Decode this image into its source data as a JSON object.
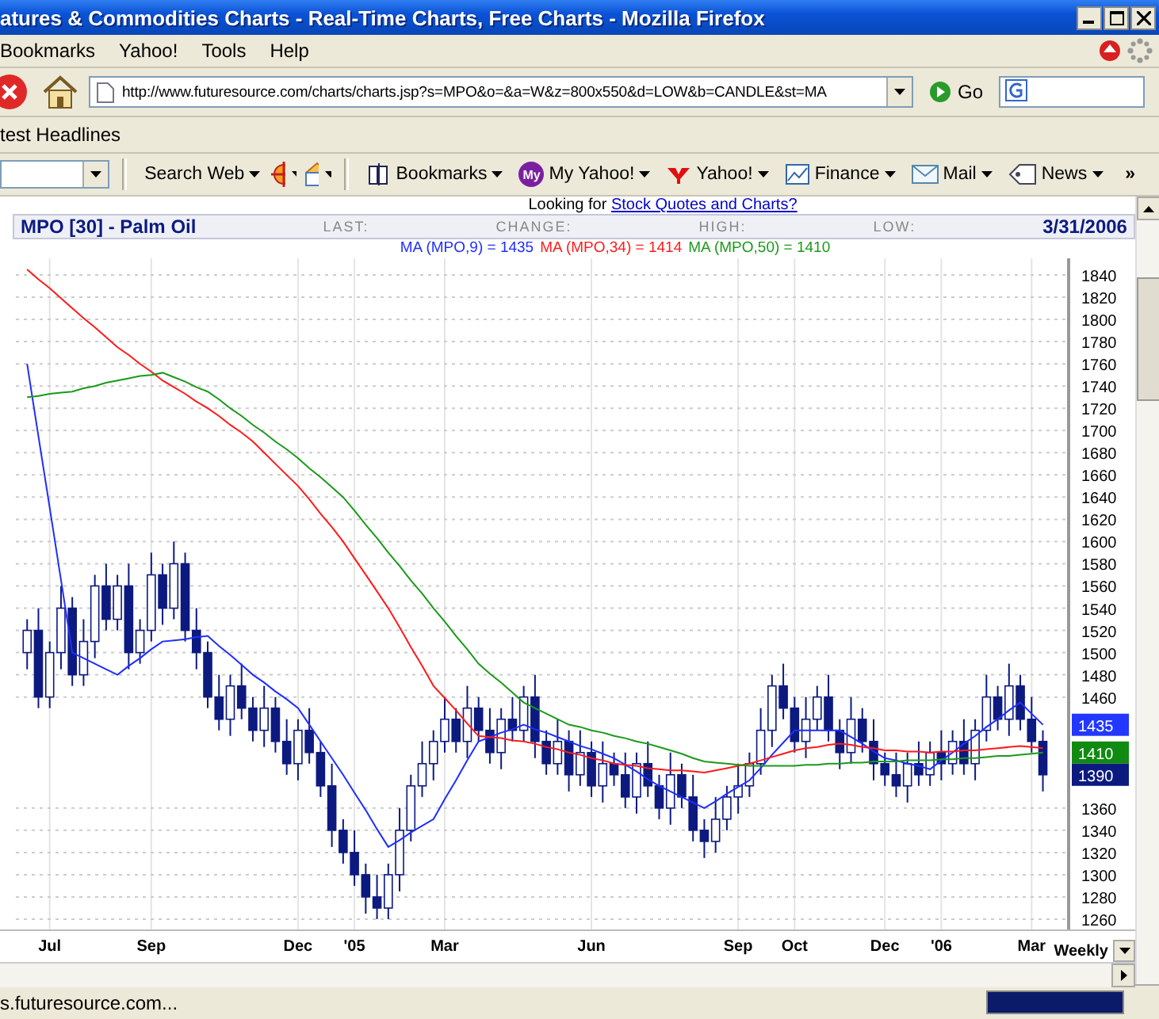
{
  "window": {
    "title": "atures & Commodities Charts - Real-Time Charts, Free Charts - Mozilla Firefox"
  },
  "menu": [
    "Bookmarks",
    "Yahoo!",
    "Tools",
    "Help"
  ],
  "navigation": {
    "url": "http://www.futuresource.com/charts/charts.jsp?s=MPO&o=&a=W&z=800x550&d=LOW&b=CANDLE&st=MA",
    "go": "Go"
  },
  "bookmarks_bar": {
    "items": [
      "test Headlines"
    ]
  },
  "yahoo_toolbar": {
    "search_button": "Search Web",
    "items": [
      {
        "kind": "bookmarks",
        "label": "Bookmarks"
      },
      {
        "kind": "myyahoo",
        "label": "My Yahoo!",
        "icon_text": "My"
      },
      {
        "kind": "yahoo",
        "label": "Yahoo!"
      },
      {
        "kind": "finance",
        "label": "Finance"
      },
      {
        "kind": "mail",
        "label": "Mail"
      },
      {
        "kind": "news",
        "label": "News"
      }
    ],
    "overflow": "»"
  },
  "page": {
    "promo": {
      "text": "Looking for",
      "link": "Stock Quotes and Charts?"
    },
    "chart": {
      "title": "MPO [30] - Palm Oil",
      "fields": [
        "LAST:",
        "CHANGE:",
        "HIGH:",
        "LOW:"
      ],
      "date": "3/31/2006",
      "legend_values": [
        "= 1435",
        "= 1414",
        "= 1410"
      ],
      "price_tags": [
        {
          "text": "1435",
          "color": "#2238ff"
        },
        {
          "text": "1410",
          "color": "#108a10"
        },
        {
          "text": "1390",
          "color": "#0c1a80"
        }
      ],
      "period": "Weekly",
      "chart_data": {
        "type": "candlestick",
        "ylim": [
          1250,
          1855
        ],
        "grid": true,
        "categories": [
          null,
          null,
          "Jul",
          null,
          null,
          null,
          null,
          null,
          null,
          null,
          null,
          "Sep",
          null,
          null,
          null,
          null,
          null,
          null,
          null,
          null,
          null,
          null,
          null,
          null,
          "Dec",
          null,
          null,
          null,
          null,
          "'05",
          null,
          null,
          null,
          null,
          null,
          null,
          null,
          "Mar",
          null,
          null,
          null,
          null,
          null,
          null,
          null,
          null,
          null,
          null,
          null,
          null,
          "Jun",
          null,
          null,
          null,
          null,
          null,
          null,
          null,
          null,
          null,
          null,
          null,
          null,
          "Sep",
          null,
          null,
          null,
          null,
          "Oct",
          null,
          null,
          null,
          null,
          null,
          null,
          null,
          "Dec",
          null,
          null,
          null,
          null,
          "'06",
          null,
          null,
          null,
          null,
          null,
          null,
          null,
          "Mar",
          null
        ],
        "yticks": [
          1260,
          1280,
          1300,
          1320,
          1340,
          1360,
          1460,
          1480,
          1500,
          1520,
          1540,
          1560,
          1580,
          1600,
          1620,
          1640,
          1660,
          1680,
          1700,
          1720,
          1740,
          1760,
          1780,
          1800,
          1820,
          1840
        ],
        "ohlc": [
          [
            1500,
            1530,
            1485,
            1520
          ],
          [
            1520,
            1540,
            1450,
            1460
          ],
          [
            1460,
            1510,
            1450,
            1500
          ],
          [
            1500,
            1560,
            1485,
            1540
          ],
          [
            1540,
            1550,
            1470,
            1480
          ],
          [
            1480,
            1530,
            1470,
            1510
          ],
          [
            1510,
            1570,
            1495,
            1560
          ],
          [
            1560,
            1580,
            1520,
            1530
          ],
          [
            1530,
            1570,
            1520,
            1560
          ],
          [
            1560,
            1580,
            1485,
            1500
          ],
          [
            1500,
            1530,
            1490,
            1520
          ],
          [
            1520,
            1590,
            1510,
            1570
          ],
          [
            1570,
            1580,
            1525,
            1540
          ],
          [
            1540,
            1600,
            1530,
            1580
          ],
          [
            1580,
            1590,
            1510,
            1520
          ],
          [
            1520,
            1540,
            1485,
            1500
          ],
          [
            1500,
            1510,
            1450,
            1460
          ],
          [
            1460,
            1480,
            1430,
            1440
          ],
          [
            1440,
            1480,
            1425,
            1470
          ],
          [
            1470,
            1490,
            1440,
            1450
          ],
          [
            1450,
            1460,
            1420,
            1430
          ],
          [
            1430,
            1470,
            1415,
            1450
          ],
          [
            1450,
            1460,
            1410,
            1420
          ],
          [
            1420,
            1440,
            1390,
            1400
          ],
          [
            1400,
            1440,
            1385,
            1430
          ],
          [
            1430,
            1450,
            1400,
            1410
          ],
          [
            1410,
            1420,
            1370,
            1380
          ],
          [
            1380,
            1400,
            1325,
            1340
          ],
          [
            1340,
            1350,
            1310,
            1320
          ],
          [
            1320,
            1340,
            1290,
            1300
          ],
          [
            1300,
            1310,
            1265,
            1280
          ],
          [
            1280,
            1300,
            1260,
            1270
          ],
          [
            1270,
            1310,
            1260,
            1300
          ],
          [
            1300,
            1360,
            1285,
            1340
          ],
          [
            1340,
            1390,
            1330,
            1380
          ],
          [
            1380,
            1420,
            1370,
            1400
          ],
          [
            1400,
            1430,
            1385,
            1420
          ],
          [
            1420,
            1460,
            1410,
            1440
          ],
          [
            1440,
            1450,
            1410,
            1420
          ],
          [
            1420,
            1470,
            1405,
            1450
          ],
          [
            1450,
            1460,
            1420,
            1430
          ],
          [
            1430,
            1450,
            1400,
            1410
          ],
          [
            1410,
            1450,
            1395,
            1440
          ],
          [
            1440,
            1460,
            1420,
            1430
          ],
          [
            1430,
            1470,
            1420,
            1460
          ],
          [
            1460,
            1480,
            1405,
            1420
          ],
          [
            1420,
            1430,
            1390,
            1400
          ],
          [
            1400,
            1440,
            1390,
            1420
          ],
          [
            1420,
            1430,
            1375,
            1390
          ],
          [
            1390,
            1430,
            1380,
            1410
          ],
          [
            1410,
            1420,
            1370,
            1380
          ],
          [
            1380,
            1420,
            1365,
            1400
          ],
          [
            1400,
            1410,
            1380,
            1390
          ],
          [
            1390,
            1410,
            1360,
            1370
          ],
          [
            1370,
            1410,
            1355,
            1400
          ],
          [
            1400,
            1420,
            1370,
            1380
          ],
          [
            1380,
            1390,
            1350,
            1360
          ],
          [
            1360,
            1410,
            1345,
            1390
          ],
          [
            1390,
            1400,
            1360,
            1370
          ],
          [
            1370,
            1390,
            1330,
            1340
          ],
          [
            1340,
            1350,
            1315,
            1330
          ],
          [
            1330,
            1370,
            1320,
            1350
          ],
          [
            1350,
            1380,
            1340,
            1370
          ],
          [
            1370,
            1400,
            1355,
            1380
          ],
          [
            1380,
            1410,
            1370,
            1400
          ],
          [
            1400,
            1450,
            1390,
            1430
          ],
          [
            1430,
            1480,
            1415,
            1470
          ],
          [
            1470,
            1490,
            1440,
            1450
          ],
          [
            1450,
            1460,
            1410,
            1420
          ],
          [
            1420,
            1460,
            1405,
            1440
          ],
          [
            1440,
            1470,
            1430,
            1460
          ],
          [
            1460,
            1480,
            1420,
            1430
          ],
          [
            1430,
            1440,
            1395,
            1410
          ],
          [
            1410,
            1460,
            1400,
            1440
          ],
          [
            1440,
            1450,
            1410,
            1420
          ],
          [
            1420,
            1440,
            1385,
            1400
          ],
          [
            1400,
            1410,
            1380,
            1390
          ],
          [
            1390,
            1410,
            1370,
            1380
          ],
          [
            1380,
            1410,
            1365,
            1400
          ],
          [
            1400,
            1420,
            1380,
            1390
          ],
          [
            1390,
            1420,
            1380,
            1410
          ],
          [
            1410,
            1430,
            1385,
            1400
          ],
          [
            1400,
            1430,
            1390,
            1420
          ],
          [
            1420,
            1440,
            1390,
            1400
          ],
          [
            1400,
            1440,
            1385,
            1430
          ],
          [
            1430,
            1480,
            1420,
            1460
          ],
          [
            1460,
            1470,
            1430,
            1440
          ],
          [
            1440,
            1490,
            1425,
            1470
          ],
          [
            1470,
            1480,
            1430,
            1440
          ],
          [
            1440,
            1460,
            1410,
            1420
          ],
          [
            1420,
            1430,
            1375,
            1390
          ]
        ],
        "series": [
          {
            "name": "MA (MPO,9)",
            "type": "line",
            "color": "#1e2eff",
            "values": [
              1760,
              1695,
              1630,
              1565,
              1500,
              1495,
              1490,
              1485,
              1480,
              1488,
              1495,
              1503,
              1510,
              1511,
              1512,
              1514,
              1515,
              1506,
              1498,
              1489,
              1480,
              1473,
              1465,
              1458,
              1450,
              1435,
              1420,
              1405,
              1390,
              1374,
              1358,
              1341,
              1325,
              1331,
              1338,
              1344,
              1350,
              1368,
              1385,
              1403,
              1420,
              1424,
              1428,
              1431,
              1435,
              1431,
              1428,
              1424,
              1420,
              1416,
              1413,
              1409,
              1405,
              1399,
              1393,
              1386,
              1380,
              1375,
              1370,
              1365,
              1360,
              1366,
              1373,
              1379,
              1385,
              1396,
              1408,
              1419,
              1430,
              1430,
              1430,
              1430,
              1430,
              1424,
              1418,
              1411,
              1405,
              1403,
              1400,
              1398,
              1395,
              1403,
              1410,
              1418,
              1425,
              1433,
              1440,
              1448,
              1455,
              1445,
              1435
            ]
          },
          {
            "name": "MA (MPO,34)",
            "type": "line",
            "color": "#ff1a1a",
            "values": [
              1845,
              1836,
              1828,
              1819,
              1810,
              1801,
              1793,
              1784,
              1775,
              1768,
              1760,
              1753,
              1745,
              1739,
              1733,
              1726,
              1720,
              1713,
              1705,
              1698,
              1690,
              1680,
              1670,
              1660,
              1650,
              1638,
              1625,
              1613,
              1600,
              1585,
              1570,
              1555,
              1540,
              1523,
              1505,
              1488,
              1470,
              1459,
              1448,
              1436,
              1425,
              1424,
              1423,
              1421,
              1420,
              1418,
              1415,
              1413,
              1410,
              1408,
              1405,
              1403,
              1400,
              1399,
              1398,
              1396,
              1395,
              1394,
              1394,
              1393,
              1392,
              1394,
              1396,
              1398,
              1400,
              1403,
              1406,
              1409,
              1412,
              1414,
              1415,
              1417,
              1418,
              1417,
              1415,
              1414,
              1412,
              1412,
              1411,
              1411,
              1410,
              1411,
              1411,
              1412,
              1412,
              1413,
              1414,
              1415,
              1416,
              1415,
              1414
            ]
          },
          {
            "name": "MA (MPO,50)",
            "type": "line",
            "color": "#1a9a1a",
            "values": [
              1730,
              1731,
              1733,
              1734,
              1735,
              1738,
              1740,
              1743,
              1745,
              1747,
              1749,
              1750,
              1752,
              1748,
              1744,
              1739,
              1735,
              1728,
              1720,
              1713,
              1705,
              1698,
              1690,
              1683,
              1675,
              1666,
              1658,
              1649,
              1640,
              1628,
              1615,
              1603,
              1590,
              1578,
              1565,
              1553,
              1540,
              1528,
              1515,
              1503,
              1490,
              1481,
              1473,
              1464,
              1455,
              1450,
              1445,
              1440,
              1435,
              1433,
              1430,
              1428,
              1425,
              1423,
              1420,
              1418,
              1415,
              1412,
              1409,
              1405,
              1402,
              1401,
              1400,
              1399,
              1398,
              1398,
              1398,
              1398,
              1398,
              1399,
              1399,
              1400,
              1400,
              1401,
              1401,
              1402,
              1402,
              1402,
              1403,
              1403,
              1403,
              1404,
              1404,
              1405,
              1405,
              1406,
              1407,
              1407,
              1408,
              1409,
              1410
            ]
          }
        ]
      }
    }
  },
  "status_bar": {
    "text": "s.futuresource.com...",
    "progress": {
      "level": 1
    }
  }
}
